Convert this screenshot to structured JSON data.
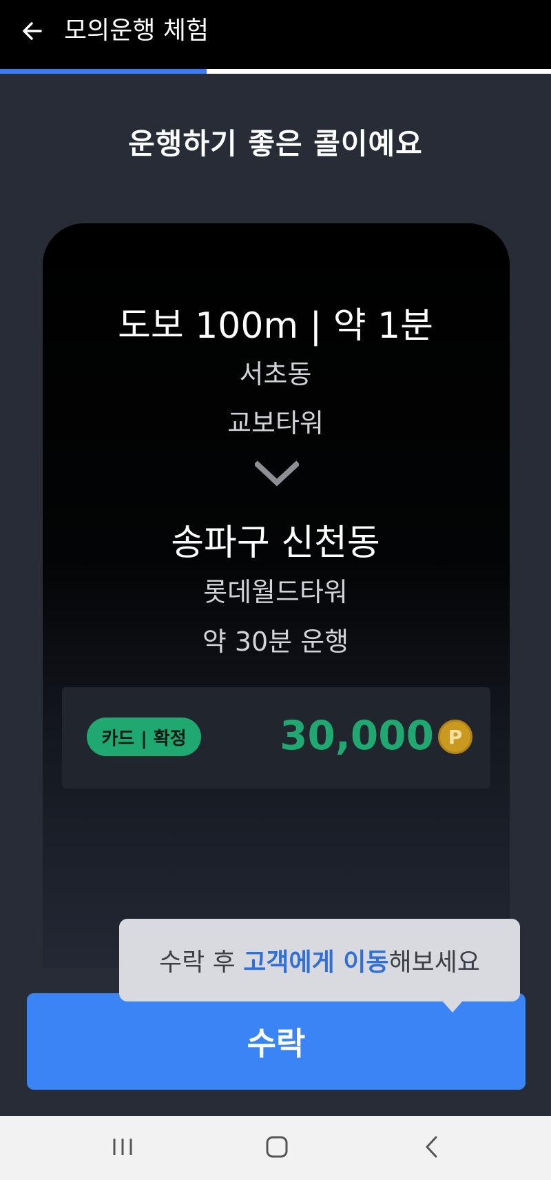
{
  "header": {
    "title": "모의운행 체험",
    "back_icon": "arrow-left-icon",
    "progress": 0.375
  },
  "headline": "운행하기 좋은 콜이예요",
  "call": {
    "pickup_info": "도보 100m | 약 1분",
    "pickup_area": "서초동",
    "pickup_place": "교보타워",
    "direction_icon": "chevron-down-icon",
    "dest_area": "송파구 신천동",
    "dest_place": "롯데월드타워",
    "duration": "약 30분 운행",
    "payment_badge": "카드 | 확정",
    "fare": "30,000",
    "point_icon": "P"
  },
  "tooltip": {
    "prefix": "수락 후 ",
    "highlight": "고객에게 이동",
    "suffix": "해보세요"
  },
  "accept_button": "수락",
  "nav": {
    "recents_icon": "recent-apps-icon",
    "home_icon": "home-icon",
    "back_icon": "back-icon"
  },
  "colors": {
    "accent": "#3a84f5",
    "fare_green": "#1fa971",
    "progress": "#3b7cf0",
    "background": "#272c37"
  }
}
